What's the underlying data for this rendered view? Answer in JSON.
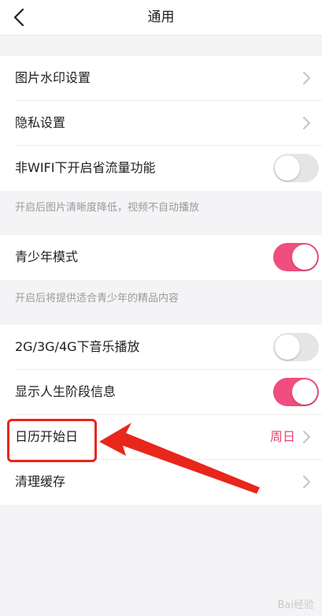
{
  "header": {
    "title": "通用",
    "back_icon": "chevron-left-icon"
  },
  "rows": {
    "watermark": {
      "label": "图片水印设置"
    },
    "privacy": {
      "label": "隐私设置"
    },
    "non_wifi": {
      "label": "非WIFI下开启省流量功能",
      "toggle": "off"
    },
    "teen_mode": {
      "label": "青少年模式",
      "toggle": "on"
    },
    "music_2g": {
      "label": "2G/3G/4G下音乐播放",
      "toggle": "off"
    },
    "life_stage": {
      "label": "显示人生阶段信息",
      "toggle": "on"
    },
    "calendar": {
      "label": "日历开始日",
      "value": "周日"
    },
    "cache": {
      "label": "清理缓存"
    }
  },
  "hints": {
    "non_wifi": "开启后图片清晰度降低，视频不自动播放",
    "teen_mode": "开启后将提供适合青少年的精品内容"
  },
  "watermark_text": "Bai经验",
  "colors": {
    "accent": "#f04e7e",
    "annotation": "#e8261b"
  }
}
